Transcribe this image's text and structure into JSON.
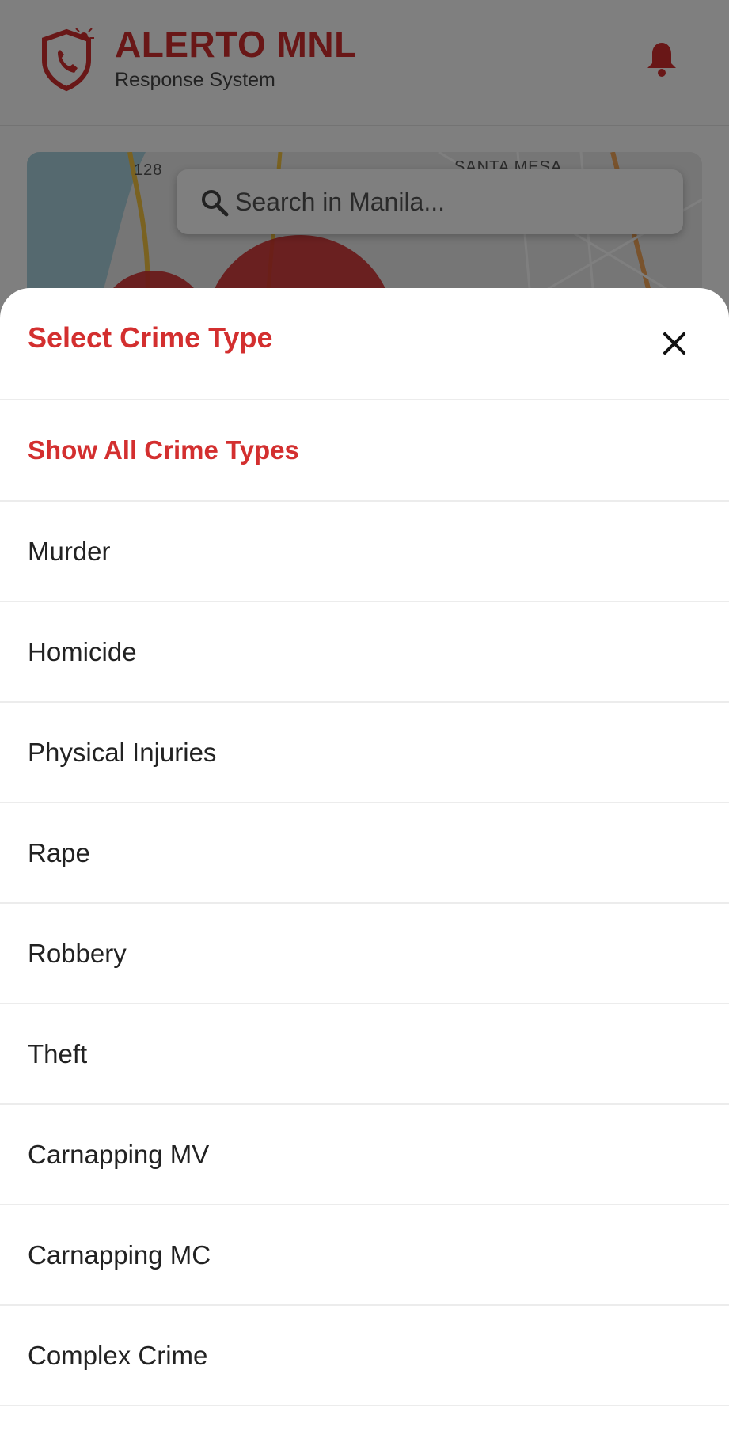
{
  "app": {
    "title": "ALERTO MNL",
    "subtitle": "Response System",
    "brand_color": "#d32f2f",
    "logo_icon": "shield-phone-alarm-icon",
    "notification_icon": "bell-icon"
  },
  "map": {
    "labels": [
      "128",
      "SANTA MESA"
    ],
    "search_placeholder": "Search in Manila..."
  },
  "sheet": {
    "title": "Select Crime Type",
    "close_icon": "close-icon",
    "show_all_label": "Show All Crime Types",
    "items": [
      "Murder",
      "Homicide",
      "Physical Injuries",
      "Rape",
      "Robbery",
      "Theft",
      "Carnapping MV",
      "Carnapping MC",
      "Complex Crime"
    ]
  }
}
